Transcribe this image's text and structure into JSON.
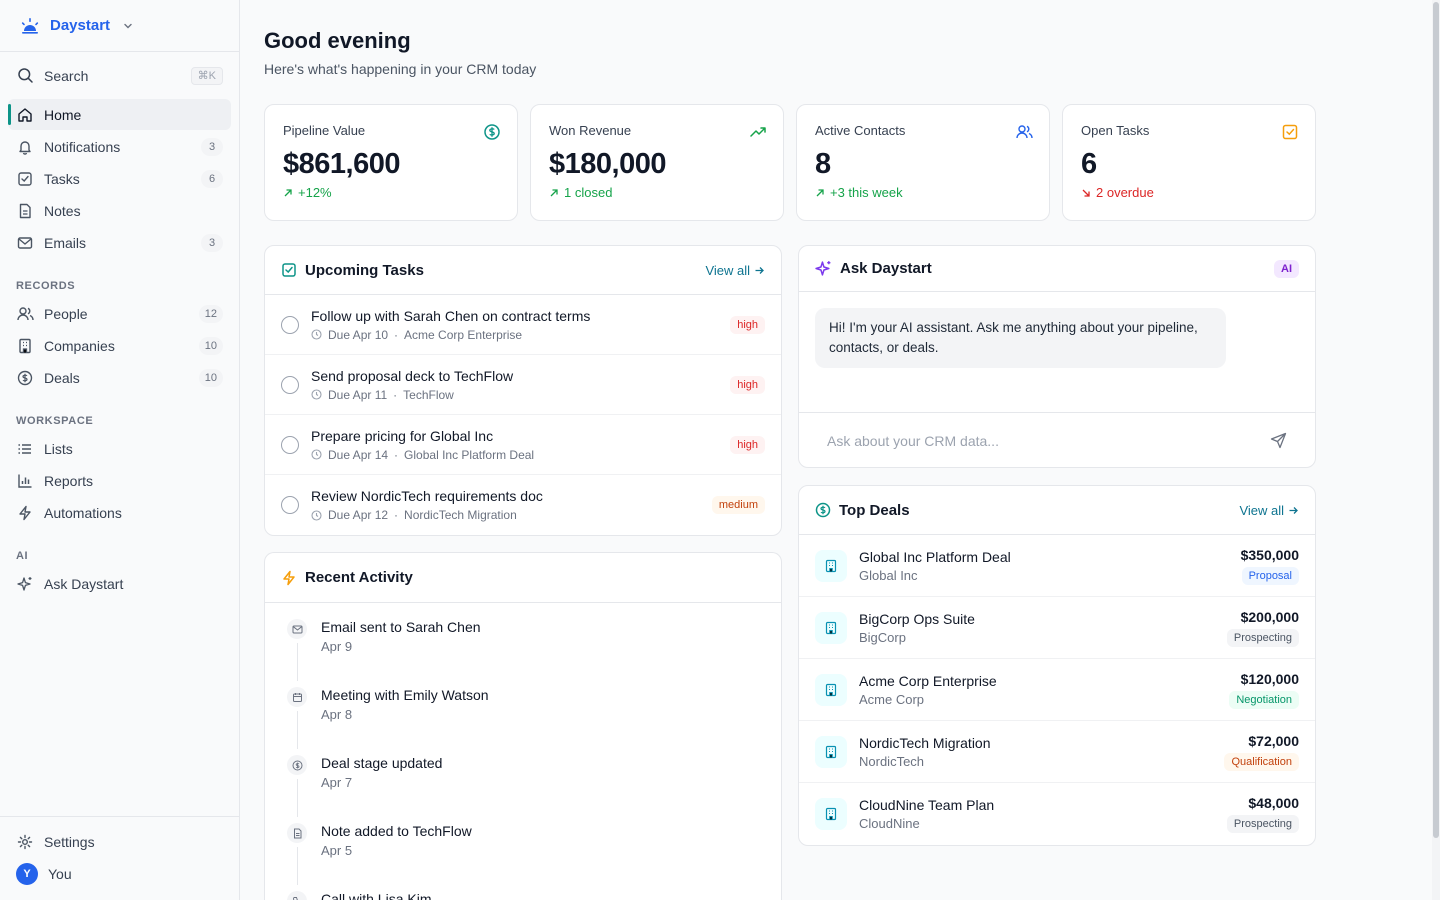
{
  "brand": {
    "name": "Daystart"
  },
  "sidebar": {
    "search": {
      "label": "Search",
      "shortcut": "⌘K"
    },
    "main_items": [
      {
        "label": "Home",
        "icon": "home-icon",
        "count": ""
      },
      {
        "label": "Notifications",
        "icon": "bell-icon",
        "count": "3"
      },
      {
        "label": "Tasks",
        "icon": "checkbox-icon",
        "count": "6"
      },
      {
        "label": "Notes",
        "icon": "note-icon",
        "count": ""
      },
      {
        "label": "Emails",
        "icon": "mail-icon",
        "count": "3"
      }
    ],
    "records_label": "RECORDS",
    "records_items": [
      {
        "label": "People",
        "icon": "people-icon",
        "count": "12"
      },
      {
        "label": "Companies",
        "icon": "building-icon",
        "count": "10"
      },
      {
        "label": "Deals",
        "icon": "dollar-icon",
        "count": "10"
      }
    ],
    "workspace_label": "WORKSPACE",
    "workspace_items": [
      {
        "label": "Lists",
        "icon": "list-icon"
      },
      {
        "label": "Reports",
        "icon": "chart-icon"
      },
      {
        "label": "Automations",
        "icon": "bolt-icon"
      }
    ],
    "ai_label": "AI",
    "ai_items": [
      {
        "label": "Ask Daystart",
        "icon": "sparkle-icon"
      }
    ],
    "settings_label": "Settings",
    "user": {
      "initial": "Y",
      "name": "You"
    }
  },
  "header": {
    "greeting": "Good evening",
    "subtitle": "Here's what's happening in your CRM today"
  },
  "stats": [
    {
      "label": "Pipeline Value",
      "value": "$861,600",
      "delta": "+12%",
      "trend": "up"
    },
    {
      "label": "Won Revenue",
      "value": "$180,000",
      "delta": "1 closed",
      "trend": "up"
    },
    {
      "label": "Active Contacts",
      "value": "8",
      "delta": "+3 this week",
      "trend": "up"
    },
    {
      "label": "Open Tasks",
      "value": "6",
      "delta": "2 overdue",
      "trend": "down"
    }
  ],
  "tasks_card": {
    "title": "Upcoming Tasks",
    "view_all": "View all",
    "items": [
      {
        "title": "Follow up with Sarah Chen on contract terms",
        "due": "Due Apr 10",
        "related": "Acme Corp Enterprise",
        "priority": "high"
      },
      {
        "title": "Send proposal deck to TechFlow",
        "due": "Due Apr 11",
        "related": "TechFlow",
        "priority": "high"
      },
      {
        "title": "Prepare pricing for Global Inc",
        "due": "Due Apr 14",
        "related": "Global Inc Platform Deal",
        "priority": "high"
      },
      {
        "title": "Review NordicTech requirements doc",
        "due": "Due Apr 12",
        "related": "NordicTech Migration",
        "priority": "medium"
      }
    ]
  },
  "activity_card": {
    "title": "Recent Activity",
    "items": [
      {
        "title": "Email sent to Sarah Chen",
        "date": "Apr 9",
        "icon": "mail-icon"
      },
      {
        "title": "Meeting with Emily Watson",
        "date": "Apr 8",
        "icon": "calendar-icon"
      },
      {
        "title": "Deal stage updated",
        "date": "Apr 7",
        "icon": "dollar-icon"
      },
      {
        "title": "Note added to TechFlow",
        "date": "Apr 5",
        "icon": "note-icon"
      },
      {
        "title": "Call with Lisa Kim",
        "date": "",
        "icon": "phone-icon"
      }
    ]
  },
  "ai_card": {
    "title": "Ask Daystart",
    "badge": "AI",
    "message": "Hi! I'm your AI assistant. Ask me anything about your pipeline, contacts, or deals.",
    "placeholder": "Ask about your CRM data..."
  },
  "deals_card": {
    "title": "Top Deals",
    "view_all": "View all",
    "items": [
      {
        "name": "Global Inc Platform Deal",
        "company": "Global Inc",
        "amount": "$350,000",
        "stage": "Proposal"
      },
      {
        "name": "BigCorp Ops Suite",
        "company": "BigCorp",
        "amount": "$200,000",
        "stage": "Prospecting"
      },
      {
        "name": "Acme Corp Enterprise",
        "company": "Acme Corp",
        "amount": "$120,000",
        "stage": "Negotiation"
      },
      {
        "name": "NordicTech Migration",
        "company": "NordicTech",
        "amount": "$72,000",
        "stage": "Qualification"
      },
      {
        "name": "CloudNine Team Plan",
        "company": "CloudNine",
        "amount": "$48,000",
        "stage": "Prospecting"
      }
    ]
  },
  "colors": {
    "accent": "#0d9488",
    "brand": "#2563eb",
    "positive": "#16a34a",
    "negative": "#dc2626"
  }
}
